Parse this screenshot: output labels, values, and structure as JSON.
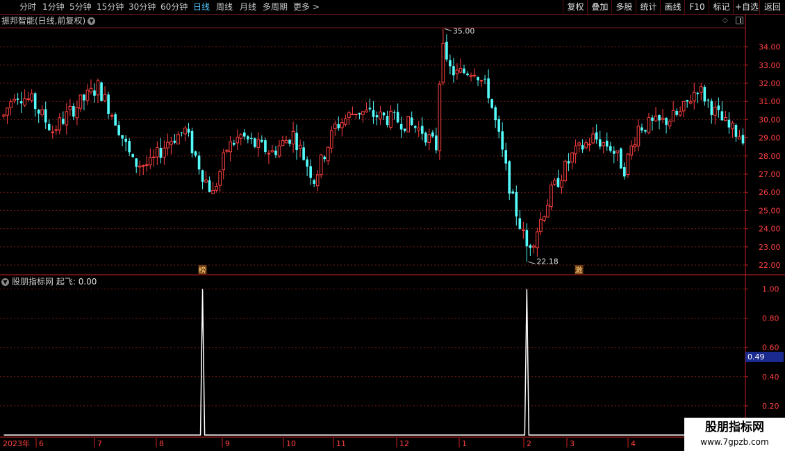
{
  "toolbar": {
    "periods": [
      {
        "label": "分时",
        "active": false
      },
      {
        "label": "1分钟",
        "active": false
      },
      {
        "label": "5分钟",
        "active": false
      },
      {
        "label": "15分钟",
        "active": false
      },
      {
        "label": "30分钟",
        "active": false
      },
      {
        "label": "60分钟",
        "active": false
      },
      {
        "label": "日线",
        "active": true
      },
      {
        "label": "周线",
        "active": false
      },
      {
        "label": "月线",
        "active": false
      },
      {
        "label": "多周期",
        "active": false
      },
      {
        "label": "更多",
        "active": false
      }
    ],
    "more_arrow": ">",
    "actions": [
      "复权",
      "叠加",
      "多股",
      "统计",
      "画线",
      "F10",
      "标记",
      "+自选",
      "返回"
    ]
  },
  "stock": {
    "title": "振邦智能(日线,前复权)",
    "dropdown_icon": "chevron-down-icon",
    "high_label": "35.00",
    "low_label": "22.18",
    "markers": [
      "榜",
      "激"
    ]
  },
  "indicator": {
    "name": "股朋指标网",
    "series_label": "起飞:",
    "value": "0.00",
    "current_value_label": "0.49"
  },
  "x_axis": {
    "year_label": "2023年",
    "months": [
      "6",
      "7",
      "8",
      "9",
      "10",
      "11",
      "12",
      "1",
      "2",
      "3",
      "4"
    ]
  },
  "watermark": {
    "line1": "股朋指标网",
    "line2": "www.7gpzb.com"
  },
  "colors": {
    "up": "#ff4040",
    "down": "#54fcfc",
    "grid": "#7a1b1b",
    "axis": "#cc2222",
    "active_tab": "#4fc3f7",
    "value_box": "#1b2a8f"
  },
  "chart_data": [
    {
      "type": "candlestick",
      "y_ticks": [
        "22.00",
        "23.00",
        "24.00",
        "25.00",
        "26.00",
        "27.00",
        "28.00",
        "29.00",
        "30.00",
        "31.00",
        "32.00",
        "33.00",
        "34.00"
      ],
      "ylim": [
        21.7,
        35.2
      ],
      "annotations": [
        {
          "text": "35.00",
          "price": 35.0
        },
        {
          "text": "22.18",
          "price": 22.18
        }
      ],
      "path_anchors": [
        [
          0,
          30.2
        ],
        [
          3,
          31.5
        ],
        [
          8,
          31.0
        ],
        [
          14,
          29.4
        ],
        [
          20,
          30.6
        ],
        [
          27,
          31.8
        ],
        [
          32,
          30.0
        ],
        [
          37,
          27.6
        ],
        [
          42,
          27.5
        ],
        [
          47,
          28.8
        ],
        [
          52,
          29.4
        ],
        [
          57,
          27.0
        ],
        [
          60,
          25.9
        ],
        [
          64,
          28.4
        ],
        [
          68,
          29.1
        ],
        [
          72,
          28.6
        ],
        [
          77,
          28.2
        ],
        [
          83,
          29.2
        ],
        [
          89,
          26.7
        ],
        [
          95,
          29.6
        ],
        [
          101,
          30.5
        ],
        [
          107,
          30.2
        ],
        [
          114,
          29.9
        ],
        [
          120,
          29.4
        ],
        [
          124,
          28.5
        ],
        [
          126,
          33.0
        ],
        [
          130,
          32.5
        ],
        [
          135,
          32.8
        ],
        [
          139,
          31.5
        ],
        [
          142,
          29.0
        ],
        [
          146,
          25.5
        ],
        [
          150,
          23.0
        ],
        [
          152,
          23.5
        ],
        [
          157,
          26.0
        ],
        [
          163,
          28.0
        ],
        [
          169,
          29.0
        ],
        [
          174,
          28.5
        ],
        [
          178,
          27.3
        ],
        [
          182,
          29.6
        ],
        [
          188,
          29.8
        ],
        [
          194,
          30.3
        ],
        [
          199,
          31.8
        ],
        [
          204,
          30.4
        ],
        [
          208,
          29.5
        ],
        [
          212,
          29.1
        ]
      ]
    },
    {
      "type": "line",
      "name": "起飞",
      "y_ticks": [
        "0.20",
        "0.40",
        "0.60",
        "0.80",
        "1.00"
      ],
      "ylim": [
        -0.03,
        1.03
      ],
      "spikes": [
        {
          "x_index": 57,
          "value": 1.0
        },
        {
          "x_index": 150,
          "value": 1.0
        }
      ],
      "baseline": 0.0
    }
  ]
}
